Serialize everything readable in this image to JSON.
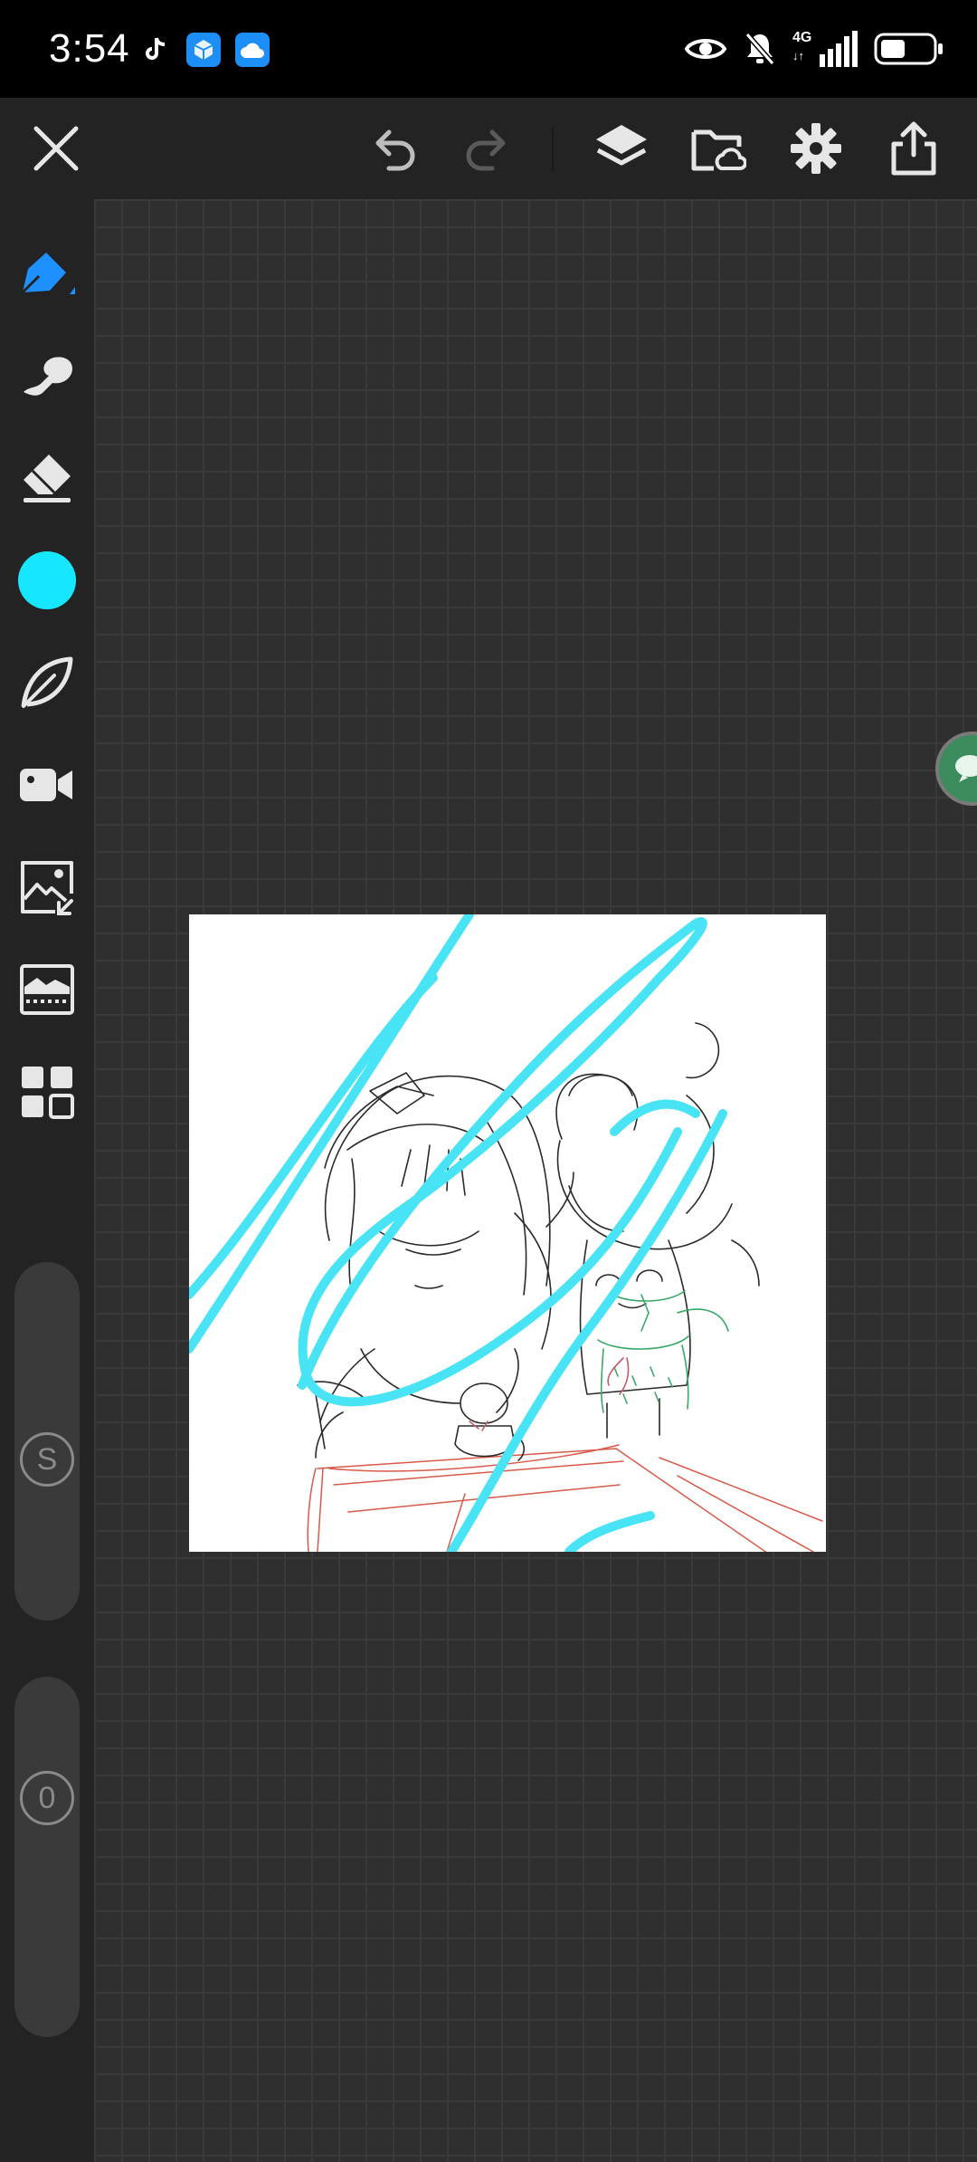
{
  "status_bar": {
    "time": "3:54",
    "network": "4G",
    "notification_apps": [
      "tiktok-icon",
      "app-cube-icon",
      "cloud-app-icon"
    ],
    "indicators": [
      "eye-icon",
      "bell-muted-icon",
      "signal-icon",
      "battery-icon"
    ]
  },
  "toolbar": {
    "buttons": [
      "close-icon",
      "undo-icon",
      "redo-icon",
      "layers-icon",
      "save-cloud-icon",
      "settings-icon",
      "share-icon"
    ]
  },
  "sidebar": {
    "tools": [
      "pen-icon",
      "smudge-icon",
      "eraser-icon",
      "color-swatch",
      "leaf-brush-icon",
      "video-icon",
      "image-import-icon",
      "filter-icon",
      "grid-menu-icon"
    ],
    "selected_tool": "pen",
    "current_color": "#17e6ff",
    "size_label": "S",
    "opacity_label": "0"
  },
  "colors": {
    "accent": "#1e90ff",
    "brush_stroke": "#48e3f5",
    "canvas_bg": "#2f2f2f",
    "panel_bg": "#232323"
  }
}
